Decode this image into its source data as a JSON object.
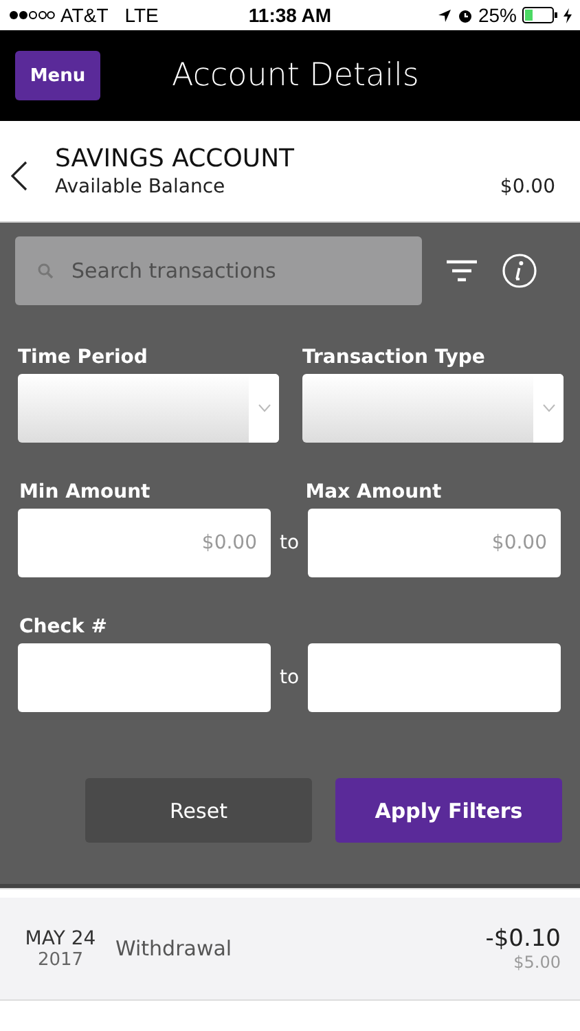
{
  "status_bar": {
    "carrier": "AT&T",
    "network": "LTE",
    "time": "11:38 AM",
    "battery": "25%"
  },
  "header": {
    "menu_button": "Menu",
    "title": "Account Details"
  },
  "account": {
    "name": "SAVINGS ACCOUNT",
    "balance_label": "Available Balance",
    "balance": "$0.00"
  },
  "filters": {
    "search": {
      "placeholder": "Search transactions"
    },
    "selects": [
      {
        "label": "Time Period"
      },
      {
        "label": "Transaction Type"
      }
    ],
    "amount": {
      "min_label": "Min Amount",
      "max_label": "Max Amount",
      "min_placeholder": "$0.00",
      "max_placeholder": "$0.00",
      "separator": "to"
    },
    "check": {
      "label": "Check #",
      "separator": "to"
    },
    "buttons": [
      {
        "label": "Reset",
        "kind": "secondary"
      },
      {
        "label": "Apply Filters",
        "kind": "primary"
      }
    ]
  },
  "transactions": [
    {
      "month_day": "MAY 24",
      "year": "2017",
      "description": "Withdrawal",
      "amount": "-$0.10",
      "balance": "$5.00"
    }
  ]
}
